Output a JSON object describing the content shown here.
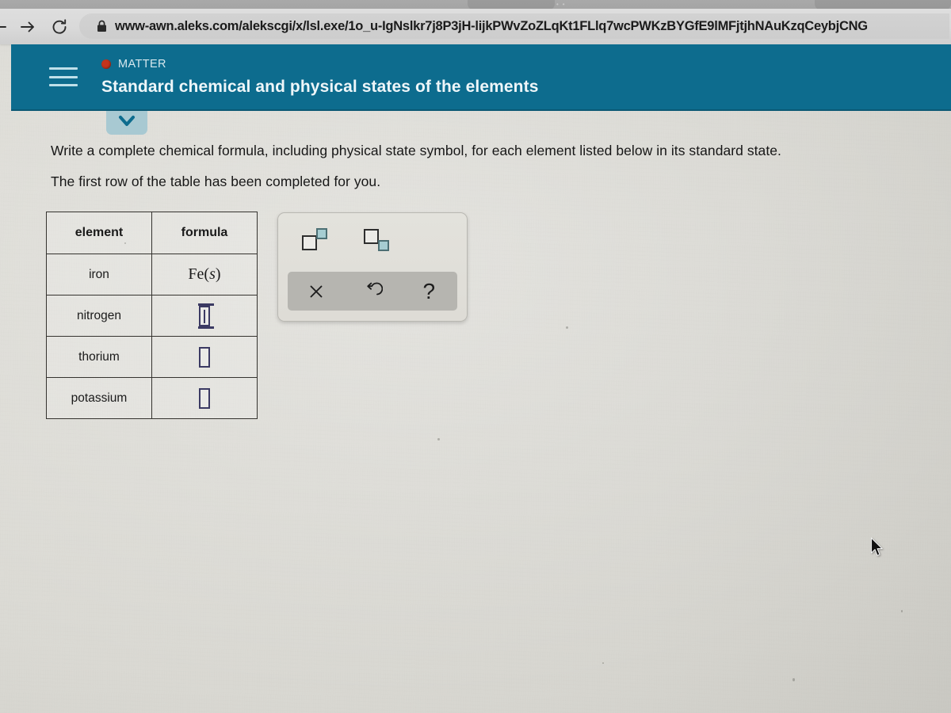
{
  "browser": {
    "url": "www-awn.aleks.com/alekscgi/x/lsl.exe/1o_u-IgNslkr7j8P3jH-lijkPWvZoZLqKt1FLlq7wcPWKzBYGfE9lMFjtjhNAuKzqCeybjCNG",
    "back_icon": "back-arrow-icon",
    "forward_icon": "forward-arrow-icon",
    "reload_icon": "reload-icon",
    "lock_icon": "lock-icon",
    "tab_dots": "••"
  },
  "header": {
    "menu_icon": "hamburger-menu-icon",
    "topic_label": "MATTER",
    "topic_dot_color": "#c4331c",
    "assignment_title": "Standard chemical and physical states of the elements",
    "background_color": "#0d6c8e",
    "collapse_icon": "chevron-down-icon"
  },
  "instructions": {
    "line_1": "Write a complete chemical formula, including physical state symbol, for each element listed below in its standard state.",
    "line_2": "The first row of the table has been completed for you."
  },
  "table": {
    "headers": [
      "element",
      "formula"
    ],
    "rows": [
      {
        "element": "iron",
        "formula_text": "Fe(s)",
        "formula_symbol": "Fe",
        "formula_state": "s",
        "filled": true,
        "active": false
      },
      {
        "element": "nitrogen",
        "formula_text": "",
        "formula_symbol": "",
        "formula_state": "",
        "filled": false,
        "active": true
      },
      {
        "element": "thorium",
        "formula_text": "",
        "formula_symbol": "",
        "formula_state": "",
        "filled": false,
        "active": false
      },
      {
        "element": "potassium",
        "formula_text": "",
        "formula_symbol": "",
        "formula_state": "",
        "filled": false,
        "active": false
      }
    ]
  },
  "math_toolbar": {
    "superscript": {
      "name": "superscript-button",
      "label": "□▪"
    },
    "subscript": {
      "name": "subscript-button",
      "label": "□▪"
    },
    "clear": {
      "name": "clear-button",
      "label": "✕"
    },
    "undo": {
      "name": "undo-button",
      "label": "↺"
    },
    "help": {
      "name": "help-button",
      "label": "?"
    },
    "accent_color": "#a6cdd2",
    "action_bar_color": "#b6b5b0"
  },
  "cursor": {
    "icon": "mouse-pointer-icon"
  }
}
